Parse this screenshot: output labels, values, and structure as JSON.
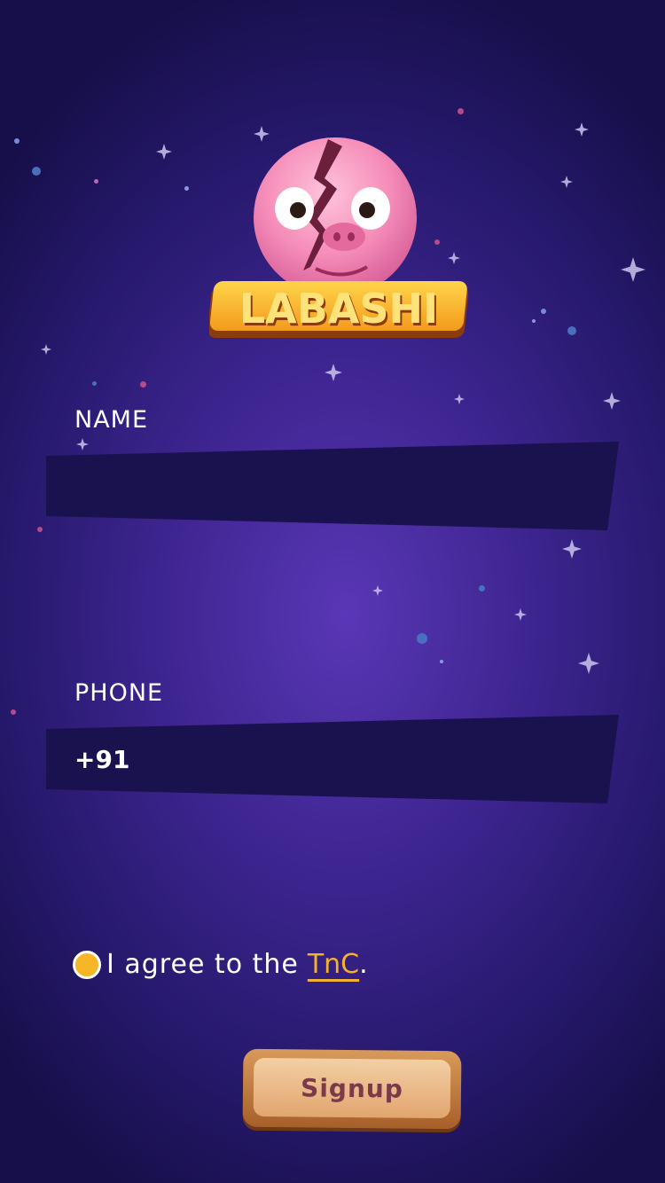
{
  "logo": {
    "text": "LABASHI"
  },
  "form": {
    "name_label": "NAME",
    "name_value": "",
    "phone_label": "PHONE",
    "phone_value": "+91"
  },
  "terms": {
    "prefix": "I agree to the ",
    "link": "TnC",
    "suffix": ".",
    "checked": true
  },
  "signup": {
    "label": "Signup"
  },
  "colors": {
    "background": "#3d2590",
    "field": "#1a114f",
    "accent": "#f4b12d"
  }
}
